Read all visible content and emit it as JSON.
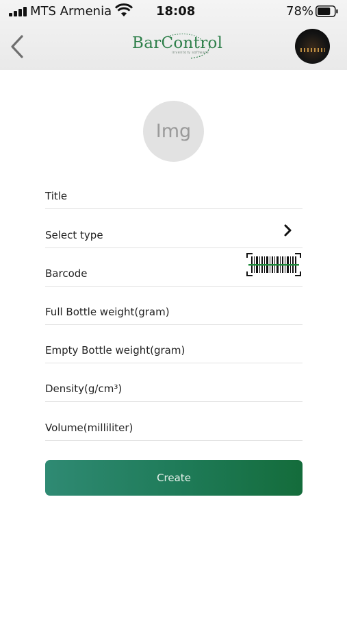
{
  "status_bar": {
    "carrier": "MTS Armenia",
    "time": "18:08",
    "battery_percent": "78%",
    "battery_level": 0.78,
    "signal_bars": 4
  },
  "header": {
    "back_icon": "chevron-left-icon",
    "logo_text": "BarControl",
    "logo_tagline": "inventory software",
    "avatar_icon": "profile-avatar"
  },
  "image_picker": {
    "placeholder": "Img"
  },
  "form": {
    "fields": [
      {
        "label": "Title"
      },
      {
        "label": "Select type",
        "icon": "chevron-right-icon"
      },
      {
        "label": "Barcode",
        "icon": "barcode-scan-icon"
      },
      {
        "label": "Full Bottle weight(gram)"
      },
      {
        "label": "Empty Bottle weight(gram)"
      },
      {
        "label": "Density(g/cm³)"
      },
      {
        "label": "Volume(milliliter)"
      }
    ],
    "submit_label": "Create"
  },
  "colors": {
    "brand_green": "#2e7f4a",
    "button_gradient_start": "#2f8a73",
    "button_gradient_end": "#146c3b"
  }
}
